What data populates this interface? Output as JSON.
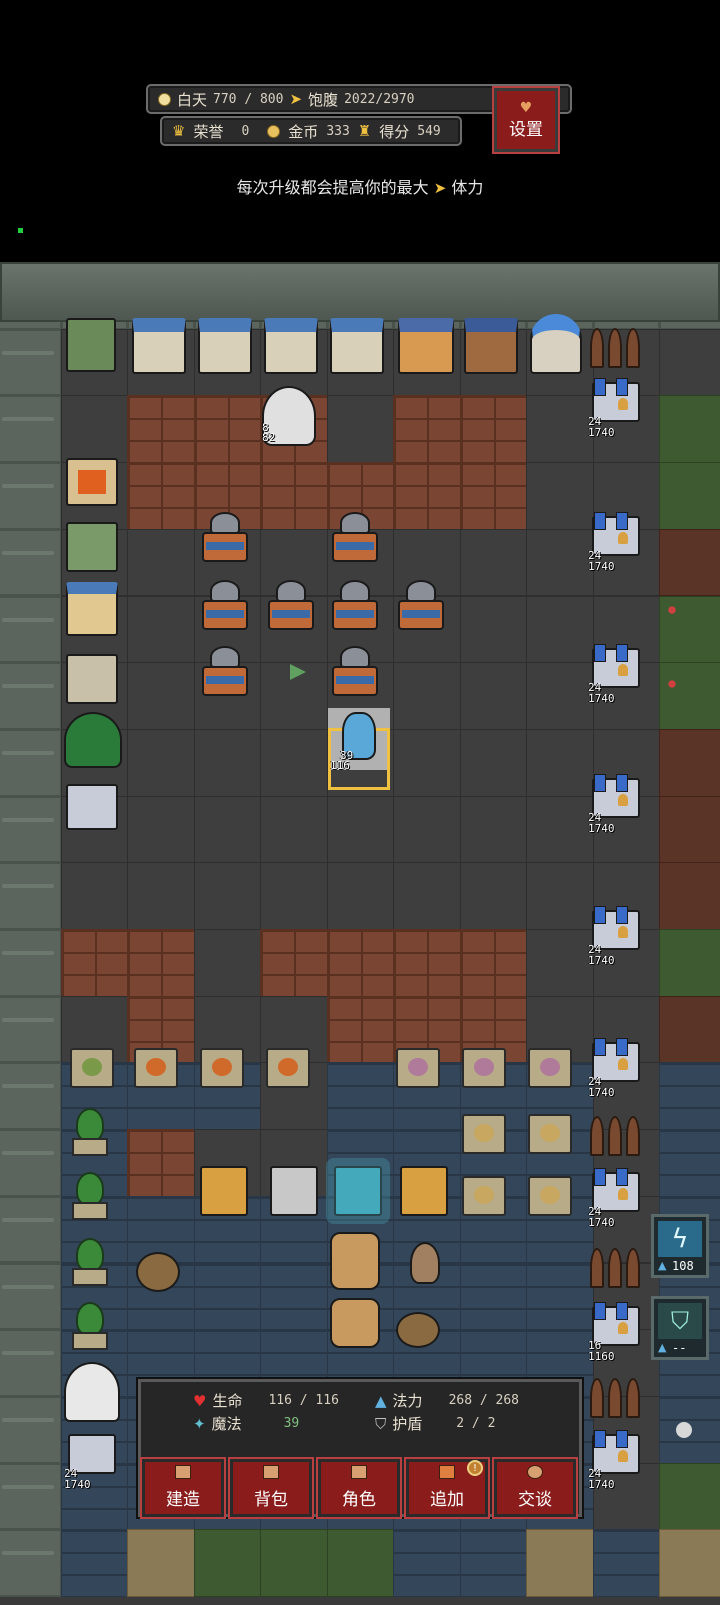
{
  "hud": {
    "time_label": "白天",
    "time_value": "770 / 800",
    "satiety_label": "饱腹",
    "satiety_value": "2022/2970",
    "honor_label": "荣誉",
    "honor_value": "0",
    "gold_label": "金币",
    "gold_value": "333",
    "score_label": "得分",
    "score_value": "549",
    "settings_label": "设置"
  },
  "tip": {
    "text_before": "每次升级都会提高你的最大",
    "text_after": "体力"
  },
  "units": {
    "npc": {
      "top": "8",
      "hp": "82"
    },
    "player": {
      "top": "39",
      "hp": "116"
    },
    "tower_top": "24",
    "tower_hp": "1740",
    "tower_weak_top": "16",
    "tower_weak_hp": "1160"
  },
  "panel": {
    "hp_label": "生命",
    "hp_value": "116 / 116",
    "mana_label": "法力",
    "mana_value": "268 / 268",
    "magic_label": "魔法",
    "magic_value": "39",
    "shield_label": "护盾",
    "shield_value": "2  /  2"
  },
  "buttons": {
    "build": "建造",
    "bag": "背包",
    "role": "角色",
    "add": "追加",
    "add_badge": "!",
    "talk": "交谈"
  },
  "skills": {
    "lightning_value": "108",
    "shield_value": "--"
  },
  "colors": {
    "button_red": "#8a1c1c",
    "selection": "#f0c040",
    "tower_blue": "#3a6ac8"
  }
}
